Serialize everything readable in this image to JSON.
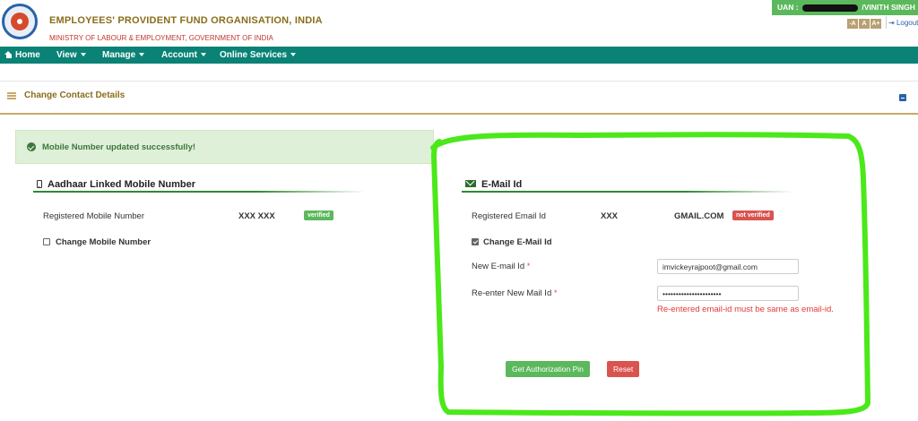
{
  "header": {
    "org_title": "EMPLOYEES' PROVIDENT FUND ORGANISATION, INDIA",
    "org_subtitle": "MINISTRY OF LABOUR & EMPLOYMENT, GOVERNMENT OF INDIA",
    "uan_prefix": "UAN :",
    "uan_name": "VINITH SINGH",
    "font_size_buttons": [
      "-A",
      "A",
      "A+"
    ],
    "logout_label": "Logout"
  },
  "nav": {
    "items": [
      {
        "label": "Home",
        "icon": "home-icon"
      },
      {
        "label": "View"
      },
      {
        "label": "Manage"
      },
      {
        "label": "Account"
      },
      {
        "label": "Online Services"
      }
    ]
  },
  "panel": {
    "title": "Change Contact Details"
  },
  "alert": {
    "message": "Mobile Number updated successfully!"
  },
  "mobile_section": {
    "title": "Aadhaar Linked Mobile Number",
    "registered_label": "Registered Mobile Number",
    "registered_value": "XXX XXX",
    "status": "verified",
    "change_label": "Change Mobile Number",
    "change_checked": false
  },
  "email_section": {
    "title": "E-Mail Id",
    "registered_label": "Registered Email Id",
    "registered_value_prefix": "XXX",
    "registered_value_suffix": "GMAIL.COM",
    "status": "not verified",
    "change_label": "Change E-Mail Id",
    "change_checked": true,
    "new_email_label": "New E-mail Id",
    "new_email_value": "imvickeyrajpoot@gmail.com",
    "reenter_label": "Re-enter New Mail Id",
    "reenter_value": "••••••••••••••••••••••",
    "error_message": "Re-entered email-id must be same as email-id.",
    "required_mark": "*",
    "get_pin_label": "Get Authorization Pin",
    "reset_label": "Reset"
  },
  "colors": {
    "nav_bg": "#0a8276",
    "accent_gold": "#8a6d1a",
    "success_green": "#5cb85c",
    "danger_red": "#d9534f",
    "annotation_green": "#4be81a"
  }
}
